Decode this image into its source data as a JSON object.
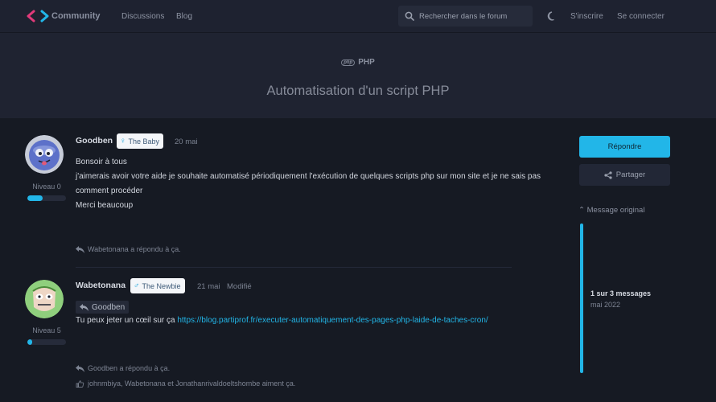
{
  "header": {
    "logo_text": "Community",
    "nav": [
      "Discussions",
      "Blog"
    ],
    "search_placeholder": "Rechercher dans le forum",
    "signup": "S'inscrire",
    "login": "Se connecter",
    "accent": "#22b6e8"
  },
  "discussion": {
    "tag_icon": "php",
    "tag": "PHP",
    "title": "Automatisation d'un script PHP"
  },
  "posts": [
    {
      "author": "Goodben",
      "badge": "The Baby",
      "date": "20 mai",
      "level_label": "Niveau 0",
      "level_progress": 0.4,
      "body": [
        "Bonsoir à tous",
        "j'aimerais avoir votre aide je souhaite automatisé périodiquement l'exécution de quelques scripts php sur mon site et je ne sais pas comment procéder",
        "Merci beaucoup"
      ],
      "replied": "Wabetonana a répondu à ça."
    },
    {
      "author": "Wabetonana",
      "badge": "The Newbie",
      "date": "21 mai",
      "edited": "Modifié",
      "level_label": "Niveau 5",
      "level_progress": 0.12,
      "mention": "Goodben",
      "body_prefix": "Tu peux jeter un cœil sur ça ",
      "body_link": "https://blog.partiprof.fr/executer-automatiquement-des-pages-php-laide-de-taches-cron/",
      "replied": "Goodben a répondu à ça.",
      "likes": "johnmbiya, Wabetonana et Jonathanrivaldoeltshombe aiment ça."
    }
  ],
  "sidebar": {
    "reply_button": "Répondre",
    "share_button": "Partager",
    "original": "Message original",
    "count": "1 sur 3 messages",
    "date": "mai 2022"
  }
}
